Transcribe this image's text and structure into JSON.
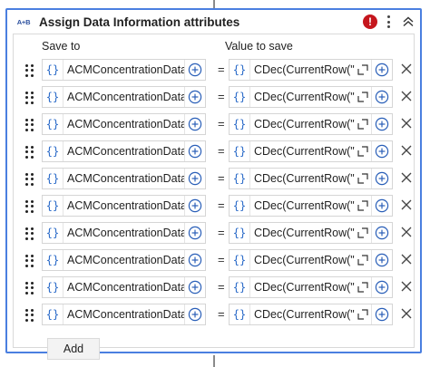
{
  "activity": {
    "icon_text": "A+B",
    "title": "Assign Data Information attributes",
    "error_symbol": "!"
  },
  "columns": {
    "save_to": "Save to",
    "value_to_save": "Value to save"
  },
  "assignments": [
    {
      "save_to": "ACMConcentrationDataRe",
      "value": "CDec(CurrentRow(\"Ye"
    },
    {
      "save_to": "ACMConcentrationDataRe",
      "value": "CDec(CurrentRow(\"Ol"
    },
    {
      "save_to": "ACMConcentrationDataRe",
      "value": "CDec(CurrentRow(\"Ol"
    },
    {
      "save_to": "ACMConcentrationDataRe",
      "value": "CDec(CurrentRow(\"Va"
    },
    {
      "save_to": "ACMConcentrationDataRe",
      "value": "CDec(CurrentRow(\"Re"
    },
    {
      "save_to": "ACMConcentrationDataRe",
      "value": "CDec(CurrentRow(\"Ex"
    },
    {
      "save_to": "ACMConcentrationDataRe",
      "value": "CDec(CurrentRow(\"Nu"
    },
    {
      "save_to": "ACMConcentrationDataRe",
      "value": "CDec(CurrentRow(\"Pri"
    },
    {
      "save_to": "ACMConcentrationDataRe",
      "value": "CDec(CurrentRow(\"Re"
    },
    {
      "save_to": "ACMConcentrationDataRe",
      "value": "CDec(CurrentRow(\"Re"
    }
  ],
  "equals_sign": "=",
  "braces_symbol": "{}",
  "add_label": "Add",
  "colors": {
    "accent_border": "#4a7fe0",
    "error": "#c5161d",
    "variable_icon": "#2a6ac8"
  }
}
